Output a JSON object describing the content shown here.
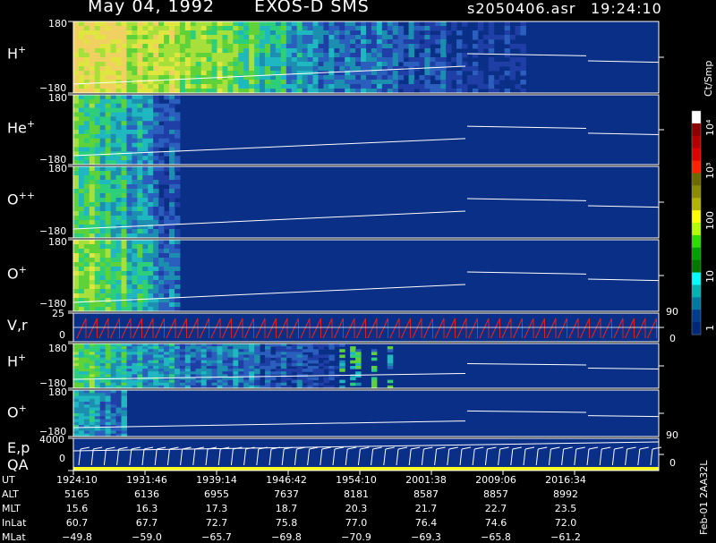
{
  "header": {
    "date": "May 04, 1992",
    "instrument": "EXOS-D SMS",
    "file": "s2050406.asr",
    "time": "19:24:10"
  },
  "panels": [
    {
      "label": "H",
      "charge": "+",
      "top_tick": "180",
      "bottom_tick": "−180"
    },
    {
      "label": "He",
      "charge": "+",
      "top_tick": "180",
      "bottom_tick": "−180"
    },
    {
      "label": "O",
      "charge": "++",
      "top_tick": "180",
      "bottom_tick": "−180"
    },
    {
      "label": "O",
      "charge": "+",
      "top_tick": "180",
      "bottom_tick": "−180"
    },
    {
      "label": "V,r",
      "charge": "",
      "top_tick": "25",
      "mid_tick": "0",
      "bottom_tick": "",
      "right_top": "90",
      "right_bottom": "0"
    },
    {
      "label": "H",
      "charge": "+",
      "top_tick": "180",
      "bottom_tick": "−180"
    },
    {
      "label": "O",
      "charge": "+",
      "top_tick": "180",
      "bottom_tick": "−180"
    },
    {
      "label": "E,p",
      "label2": "QA",
      "charge": "",
      "top_tick": "4000",
      "mid_tick": "0",
      "bottom_tick": "",
      "right_top": "90",
      "right_bottom": "0"
    }
  ],
  "colorbar": {
    "unit": "Ct/Smp",
    "ticks": [
      "10⁴",
      "10³",
      "100",
      "10",
      "1"
    ],
    "colors": [
      "#ffffff",
      "#8c0000",
      "#b40000",
      "#e00000",
      "#ff2000",
      "#6b6b00",
      "#8c8c00",
      "#b4b400",
      "#ffff00",
      "#b4ff00",
      "#2edc00",
      "#00a000",
      "#007800",
      "#00ffff",
      "#00b4b4",
      "#0078a0",
      "#003c8c",
      "#002878"
    ]
  },
  "footer_id": "Feb-01 2AA32L",
  "orbit": {
    "labels": [
      "UT",
      "ALT",
      "MLT",
      "InLat",
      "MLat"
    ],
    "columns": [
      {
        "UT": "1924:10",
        "ALT": "5165",
        "MLT": "15.6",
        "InLat": "60.7",
        "MLat": "−49.8"
      },
      {
        "UT": "1931:46",
        "ALT": "6136",
        "MLT": "16.3",
        "InLat": "67.7",
        "MLat": "−59.0"
      },
      {
        "UT": "1939:14",
        "ALT": "6955",
        "MLT": "17.3",
        "InLat": "72.7",
        "MLat": "−65.7"
      },
      {
        "UT": "1946:42",
        "ALT": "7637",
        "MLT": "18.7",
        "InLat": "75.8",
        "MLat": "−69.8"
      },
      {
        "UT": "1954:10",
        "ALT": "8181",
        "MLT": "20.3",
        "InLat": "77.0",
        "MLat": "−70.9"
      },
      {
        "UT": "2001:38",
        "ALT": "8587",
        "MLT": "21.7",
        "InLat": "76.4",
        "MLat": "−69.3"
      },
      {
        "UT": "2009:06",
        "ALT": "8857",
        "MLT": "22.7",
        "InLat": "74.6",
        "MLat": "−65.8"
      },
      {
        "UT": "2016:34",
        "ALT": "8992",
        "MLT": "23.5",
        "InLat": "72.0",
        "MLat": "−61.2"
      }
    ]
  },
  "chart_data": {
    "type": "heatmap",
    "x_tick_labels": [
      "1924:10",
      "1931:46",
      "1939:14",
      "1946:42",
      "1954:10",
      "2001:38",
      "2009:06",
      "2016:34"
    ],
    "y_range_pitch": [
      -180,
      180
    ],
    "colorbar_range": [
      1,
      10000
    ],
    "colorbar_scale": "log",
    "series": [
      {
        "name": "H+",
        "intensity_profile": [
          9,
          9,
          8,
          8,
          7,
          7,
          6,
          5,
          4,
          3,
          3,
          3,
          2,
          2,
          1,
          1,
          1,
          0,
          0,
          0,
          0,
          0
        ]
      },
      {
        "name": "He+",
        "intensity_profile": [
          6,
          5,
          4,
          2,
          0,
          0,
          0,
          0,
          0,
          0,
          0,
          0,
          0,
          0,
          0,
          0,
          0,
          0,
          0,
          0,
          0,
          0
        ]
      },
      {
        "name": "O++",
        "intensity_profile": [
          6,
          5,
          4,
          2,
          0,
          0,
          0,
          0,
          0,
          0,
          0,
          0,
          0,
          0,
          0,
          0,
          0,
          0,
          0,
          0,
          0,
          0
        ]
      },
      {
        "name": "O+",
        "intensity_profile": [
          7,
          6,
          5,
          3,
          0,
          0,
          0,
          0,
          0,
          0,
          0,
          0,
          0,
          0,
          0,
          0,
          0,
          0,
          0,
          0,
          0,
          0
        ]
      },
      {
        "name": "H+ (2)",
        "intensity_profile": [
          6,
          5,
          4,
          4,
          3,
          3,
          3,
          2,
          2,
          1,
          0,
          0,
          0,
          0,
          0,
          0,
          0,
          0,
          0,
          0,
          0,
          0
        ]
      },
      {
        "name": "O+ (2)",
        "intensity_profile": [
          4,
          3,
          0,
          0,
          0,
          0,
          0,
          0,
          0,
          0,
          0,
          0,
          0,
          0,
          0,
          0,
          0,
          0,
          0,
          0,
          0,
          0
        ]
      }
    ]
  }
}
